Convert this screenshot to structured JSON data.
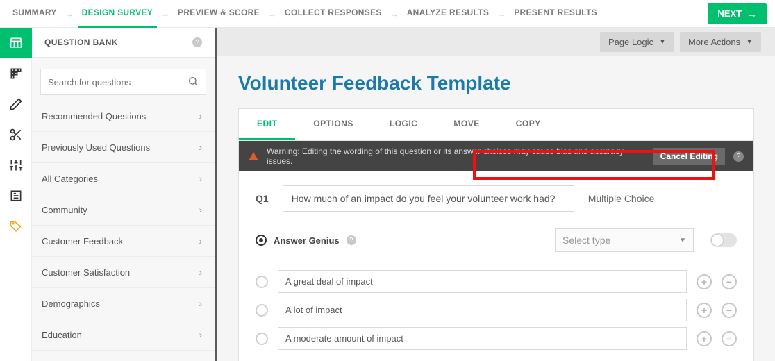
{
  "nav": {
    "steps": [
      {
        "label": "SUMMARY",
        "active": false
      },
      {
        "label": "DESIGN SURVEY",
        "active": true
      },
      {
        "label": "PREVIEW & SCORE",
        "active": false
      },
      {
        "label": "COLLECT RESPONSES",
        "active": false
      },
      {
        "label": "ANALYZE RESULTS",
        "active": false
      },
      {
        "label": "PRESENT RESULTS",
        "active": false
      }
    ],
    "next_label": "NEXT"
  },
  "sidebar": {
    "title": "QUESTION BANK",
    "search_placeholder": "Search for questions",
    "categories": [
      "Recommended Questions",
      "Previously Used Questions",
      "All Categories",
      "Community",
      "Customer Feedback",
      "Customer Satisfaction",
      "Demographics",
      "Education"
    ]
  },
  "content": {
    "page_logic_label": "Page Logic",
    "more_actions_label": "More Actions",
    "survey_title": "Volunteer Feedback Template"
  },
  "editor": {
    "tabs": [
      {
        "label": "EDIT",
        "active": true
      },
      {
        "label": "OPTIONS",
        "active": false
      },
      {
        "label": "LOGIC",
        "active": false
      },
      {
        "label": "MOVE",
        "active": false
      },
      {
        "label": "COPY",
        "active": false
      }
    ],
    "warning": "Warning: Editing the wording of this question or its answer choices may cause bias and accuracy issues.",
    "cancel_label": "Cancel Editing",
    "question_number": "Q1",
    "question_text": "How much of an impact do you feel your volunteer work had?",
    "question_type": "Multiple Choice",
    "answer_genius_label": "Answer Genius",
    "select_type_placeholder": "Select type",
    "answers": [
      "A great deal of impact",
      "A lot of impact",
      "A moderate amount of impact"
    ]
  }
}
